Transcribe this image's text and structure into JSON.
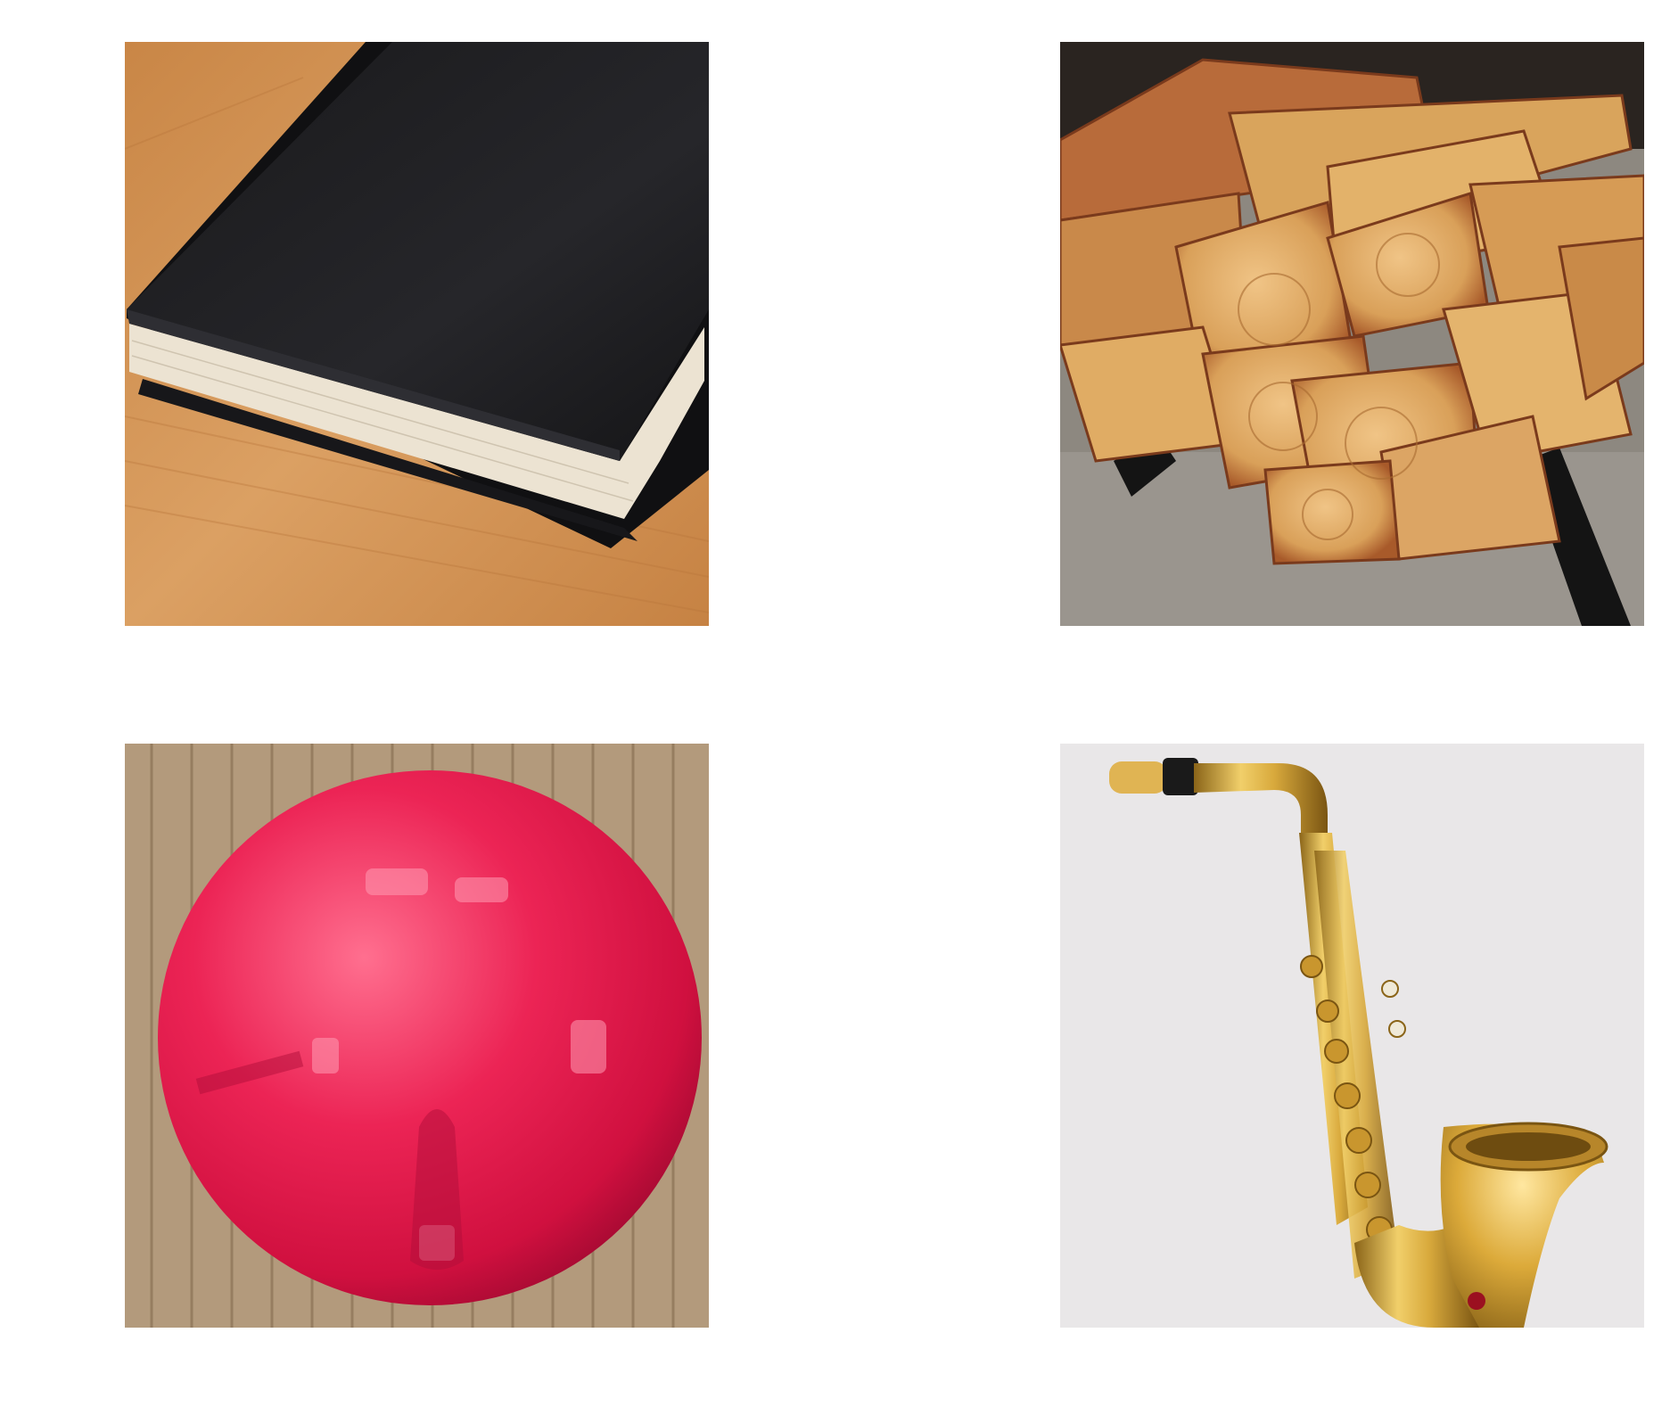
{
  "grid": {
    "rows": 2,
    "columns": 2
  },
  "photos": [
    {
      "subject": "book",
      "icon": "book-photo",
      "colors": {
        "background": "#d99a5c",
        "object": "#1c1c1e",
        "pages": "#efe6d6"
      }
    },
    {
      "subject": "firewood",
      "icon": "firewood-photo",
      "colors": {
        "background": "#8f8a82",
        "object": "#d99a55",
        "bark": "#9a4a2a"
      }
    },
    {
      "subject": "ball",
      "icon": "ball-photo",
      "colors": {
        "background": "#b59a7a",
        "object": "#e0194c",
        "highlight": "#ff8fa8"
      }
    },
    {
      "subject": "saxophone",
      "icon": "saxophone-photo",
      "colors": {
        "background": "#e9e7e8",
        "object": "#d8a93c",
        "shade": "#8a6418"
      }
    }
  ]
}
